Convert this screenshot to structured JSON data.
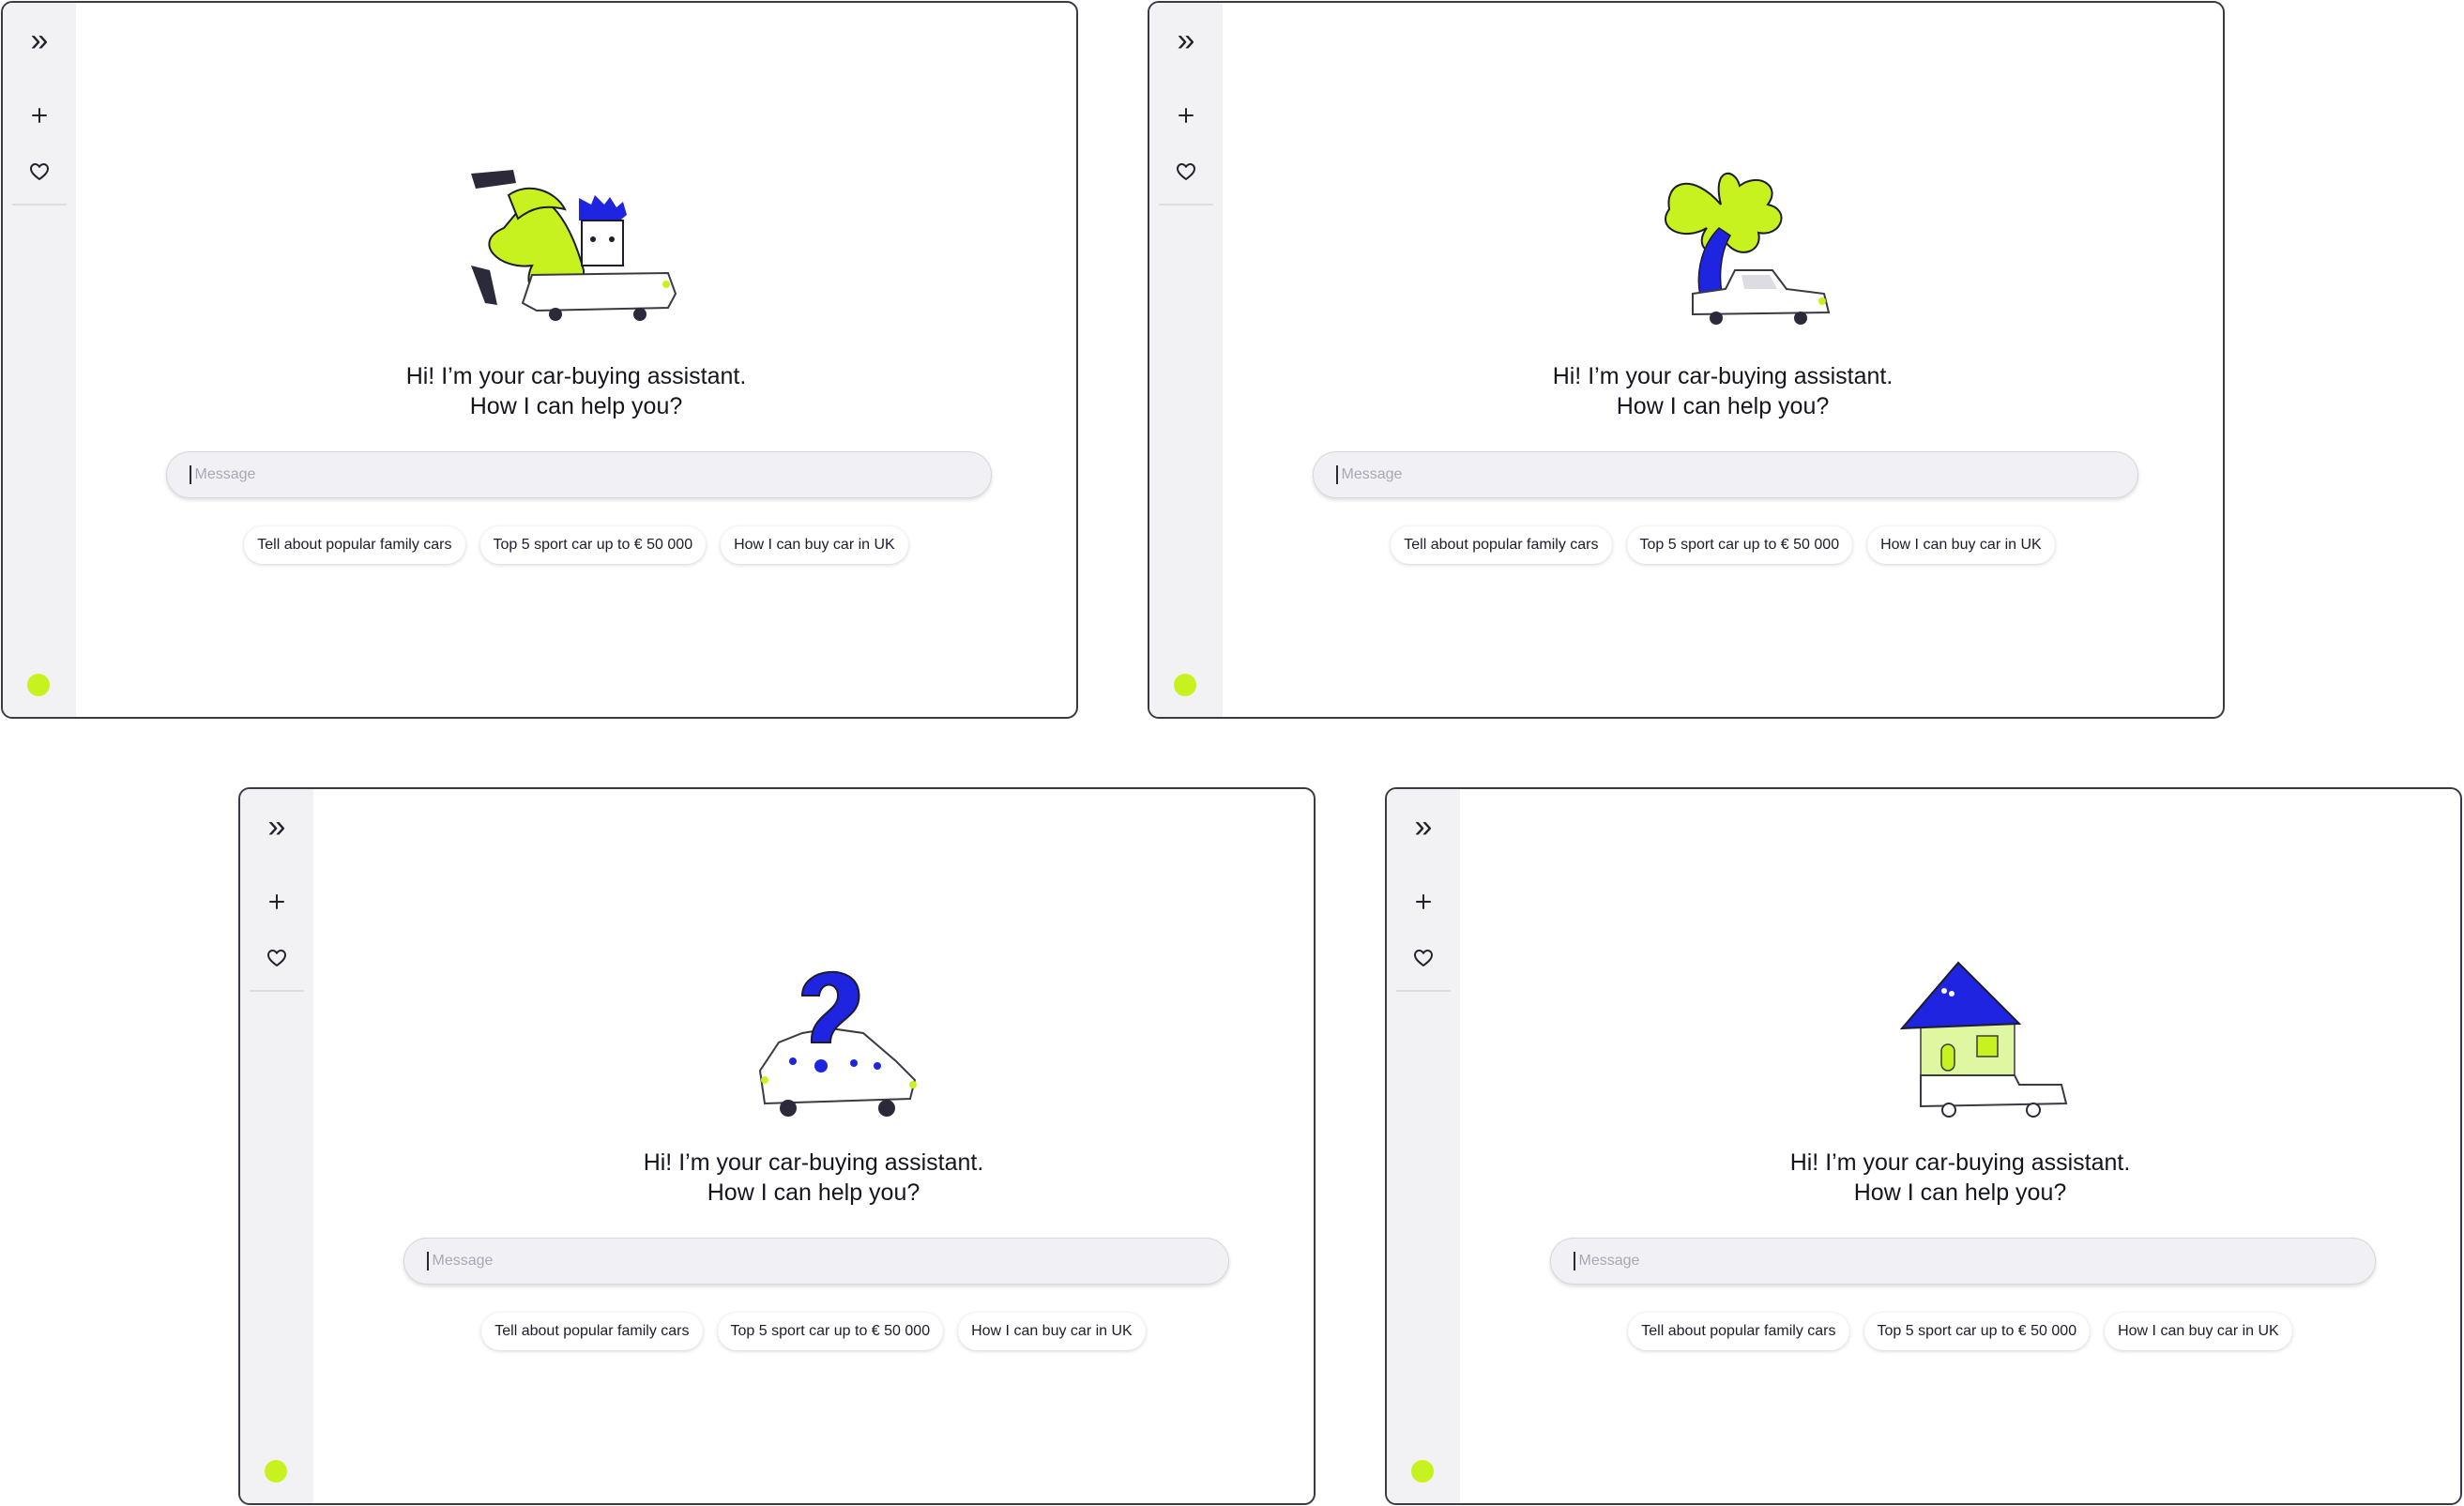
{
  "frames": [
    {
      "illustration": "car-with-person-and-plant-illustration"
    },
    {
      "illustration": "car-under-palm-tree-illustration"
    },
    {
      "illustration": "car-with-question-mark-illustration"
    },
    {
      "illustration": "car-house-illustration"
    }
  ],
  "sidebar": {
    "expand_icon": "double-chevron-right-icon",
    "new_chat_icon": "plus-icon",
    "favorites_icon": "heart-icon",
    "avatar_color": "#c8f21f"
  },
  "greeting": {
    "line1": "Hi! I’m your car-buying assistant.",
    "line2": "How I can help you?"
  },
  "message": {
    "placeholder": "Message",
    "value": ""
  },
  "suggestions": [
    {
      "label": "Tell about popular family cars"
    },
    {
      "label": "Top 5 sport car up to € 50 000"
    },
    {
      "label": "How I can buy car in UK"
    }
  ],
  "colors": {
    "accent_lime": "#c8f21f",
    "accent_blue": "#1f24e0",
    "sidebar_bg": "#f2f2f5"
  }
}
